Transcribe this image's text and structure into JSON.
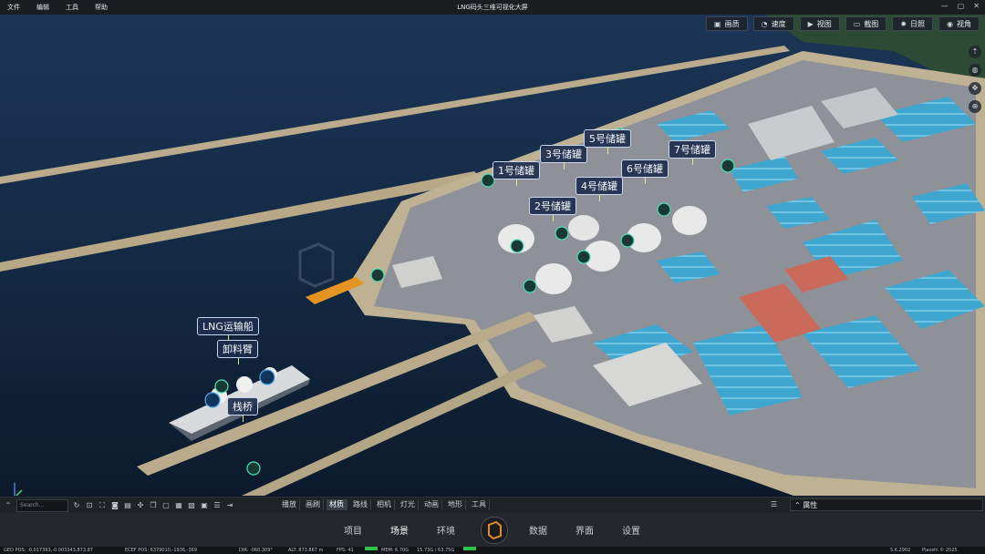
{
  "menubar": {
    "menus": [
      "文件",
      "编辑",
      "工具",
      "帮助"
    ],
    "title": "LNG码头三维可视化大屏",
    "window_controls": [
      "—",
      "▢",
      "✕"
    ]
  },
  "view_buttons": [
    {
      "icon": "image-icon",
      "glyph": "▣",
      "label": "画质"
    },
    {
      "icon": "speed-icon",
      "glyph": "◔",
      "label": "速度"
    },
    {
      "icon": "camera-view-icon",
      "glyph": "▶",
      "label": "视图"
    },
    {
      "icon": "screenshot-icon",
      "glyph": "▭",
      "label": "截图"
    },
    {
      "icon": "sun-icon",
      "glyph": "✹",
      "label": "日照"
    },
    {
      "icon": "eye-icon",
      "glyph": "◉",
      "label": "视角"
    }
  ],
  "scene_labels": {
    "tank1": "1号储罐",
    "tank2": "2号储罐",
    "tank3": "3号储罐",
    "tank4": "4号储罐",
    "tank5": "5号储罐",
    "tank6": "6号储罐",
    "tank7": "7号储罐",
    "ship": "LNG运输船",
    "unloading_arm": "卸料臂",
    "trestle": "栈桥"
  },
  "toolbar": {
    "search_placeholder": "Search...",
    "tabs": [
      {
        "icon": "play-icon",
        "label": "播放",
        "active": false
      },
      {
        "icon": "brush-icon",
        "label": "画刷",
        "active": false
      },
      {
        "icon": "material-icon",
        "label": "材质",
        "active": true
      },
      {
        "icon": "route-icon",
        "label": "路线",
        "active": false
      },
      {
        "icon": "camera-icon",
        "label": "相机",
        "active": false
      },
      {
        "icon": "light-icon",
        "label": "灯光",
        "active": false
      },
      {
        "icon": "animation-icon",
        "label": "动画",
        "active": false
      },
      {
        "icon": "terrain-icon",
        "label": "地形",
        "active": false
      },
      {
        "icon": "tools-icon",
        "label": "工具",
        "active": false
      }
    ],
    "properties_label": "属性"
  },
  "nav": {
    "items": [
      {
        "label": "项目",
        "active": false
      },
      {
        "label": "场景",
        "active": true
      },
      {
        "label": "环境",
        "active": false
      },
      {
        "label": "数据",
        "active": false
      },
      {
        "label": "界面",
        "active": false
      },
      {
        "label": "设置",
        "active": false
      }
    ]
  },
  "status": {
    "geo_pos": "GEO POS: -0.017393,-0.003343,873.87",
    "ecef_pos": "ECEF POS: 6379010,-1936,-369",
    "dir": "DIR: -060.309°",
    "alt": "ALT: 873.867 m",
    "fps": "FPS: 41",
    "mem": "MEM: 6.70G",
    "gpu_mem": "15.73G / 63.75G",
    "version": "5.6.2902",
    "copyright": "Plaoshi © 2025"
  }
}
